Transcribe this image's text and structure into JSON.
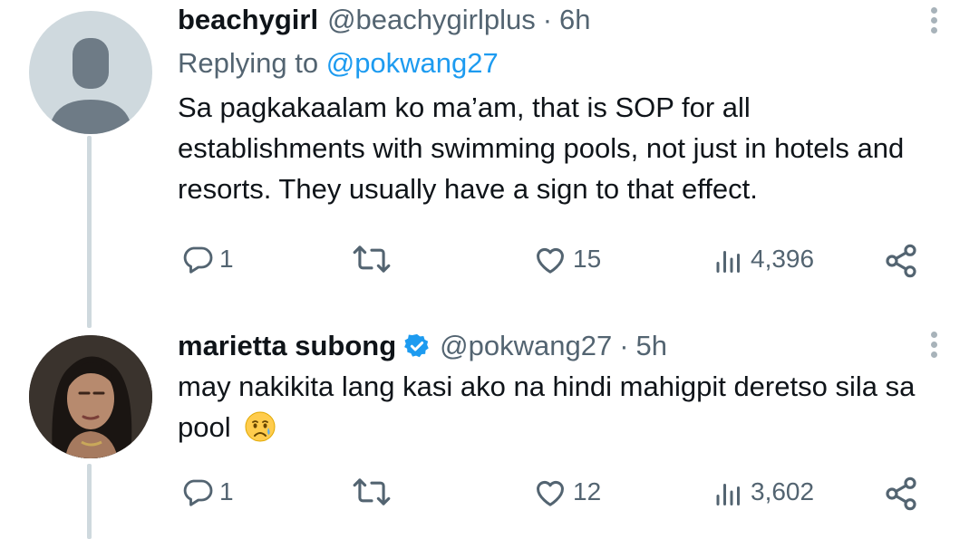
{
  "tweets": [
    {
      "name": "beachygirl",
      "handle": "@beachygirlplus",
      "dot": "·",
      "time": "6h",
      "replying_prefix": "Replying to ",
      "replying_handle": "@pokwang27",
      "text": "Sa pagkakaalam ko ma’am, that is SOP for all establishments with swimming pools, not just in hotels and resorts. They usually have a sign to that effect.",
      "verified": false,
      "stats": {
        "replies": "1",
        "retweets": "",
        "likes": "15",
        "views": "4,396"
      }
    },
    {
      "name": "marietta subong",
      "handle": "@pokwang27",
      "dot": "·",
      "time": "5h",
      "text": "may nakikita lang kasi ako na hindi mahigpit deretso sila sa pool",
      "emoji": "crying-face",
      "verified": true,
      "stats": {
        "replies": "1",
        "retweets": "",
        "likes": "12",
        "views": "3,602"
      }
    }
  ],
  "colors": {
    "text": "#0f1419",
    "secondary": "#536471",
    "accent": "#1d9bf0",
    "thread_line": "#cfd9de"
  },
  "icons": [
    "reply-icon",
    "retweet-icon",
    "like-icon",
    "views-icon",
    "share-icon",
    "more-icon",
    "verified-badge-icon"
  ]
}
